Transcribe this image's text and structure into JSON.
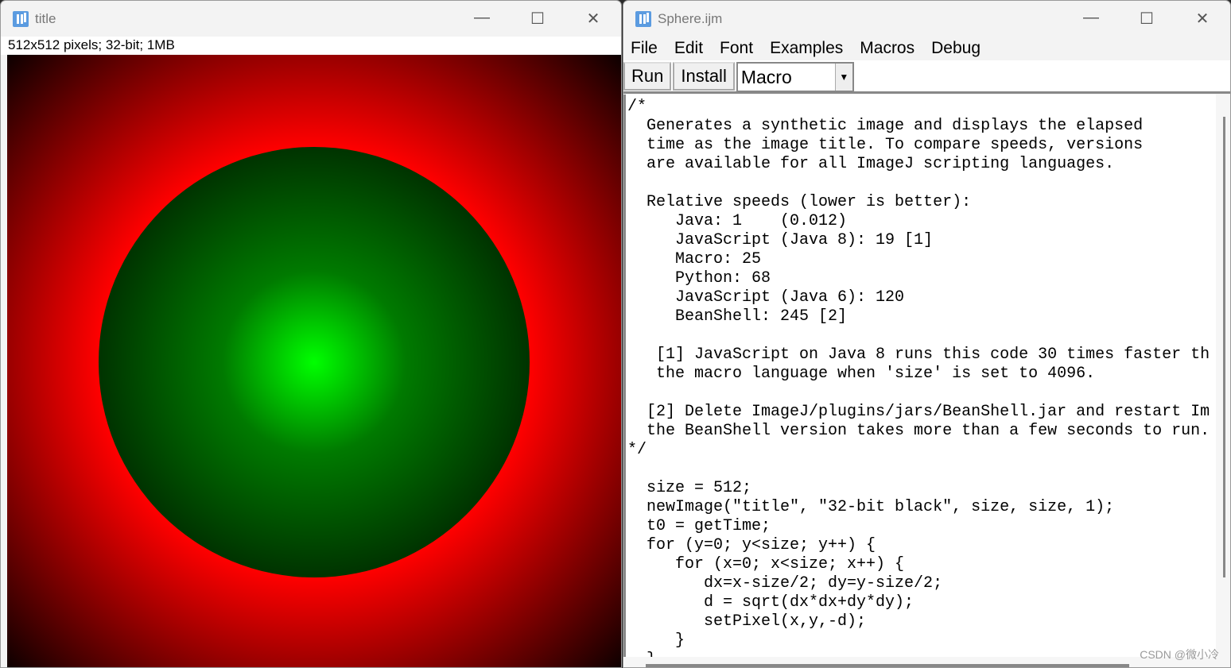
{
  "image_window": {
    "title": "title",
    "info": "512x512 pixels; 32-bit; 1MB"
  },
  "editor_window": {
    "title": "Sphere.ijm",
    "menu": [
      "File",
      "Edit",
      "Font",
      "Examples",
      "Macros",
      "Debug"
    ],
    "buttons": {
      "run": "Run",
      "install": "Install"
    },
    "language": "Macro",
    "code": "/*\n  Generates a synthetic image and displays the elapsed\n  time as the image title. To compare speeds, versions\n  are available for all ImageJ scripting languages.\n\n  Relative speeds (lower is better):\n     Java: 1    (0.012)\n     JavaScript (Java 8): 19 [1]\n     Macro: 25\n     Python: 68\n     JavaScript (Java 6): 120\n     BeanShell: 245 [2]\n\n   [1] JavaScript on Java 8 runs this code 30 times faster th\n   the macro language when 'size' is set to 4096.\n\n  [2] Delete ImageJ/plugins/jars/BeanShell.jar and restart Im\n  the BeanShell version takes more than a few seconds to run.\n*/\n\n  size = 512;\n  newImage(\"title\", \"32-bit black\", size, size, 1);\n  t0 = getTime;\n  for (y=0; y<size; y++) {\n     for (x=0; x<size; x++) {\n        dx=x-size/2; dy=y-size/2;\n        d = sqrt(dx*dx+dy*dy);\n        setPixel(x,y,-d);\n     }\n  }"
  },
  "window_controls": {
    "minimize": "—",
    "maximize": "☐",
    "close": "✕"
  },
  "watermark": "CSDN @微小冷"
}
